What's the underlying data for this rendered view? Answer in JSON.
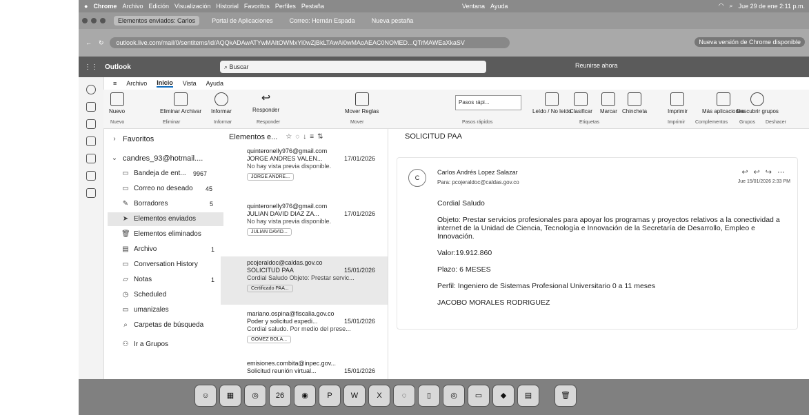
{
  "menubar": {
    "items": [
      "Chrome",
      "Archivo",
      "Edición",
      "Visualización",
      "Historial",
      "Favoritos",
      "Perfiles",
      "Pestaña",
      "Ventana",
      "Ayuda"
    ],
    "datetime": "Jue 29 de ene 2:11 p.m."
  },
  "tabs": [
    {
      "label": "Elementos enviados: Carlos"
    },
    {
      "label": "Portal de Aplicaciones"
    },
    {
      "label": "Correo: Hernán Espada"
    },
    {
      "label": "Nueva pestaña"
    }
  ],
  "address": {
    "url": "outlook.live.com/mail/0/sentitems/id/AQQkADAwATYwMAItOWMxYi0wZjBkLTAwAi0wMAoAEAC0NOMED...QTrMAWEaXkaSV",
    "new_version": "Nueva versión de Chrome disponible"
  },
  "outlook_header": {
    "app_name": "Outlook",
    "search_placeholder": "Buscar",
    "meet_now": "Reunirse ahora"
  },
  "ribbon": {
    "tabs": [
      "Archivo",
      "Inicio",
      "Vista",
      "Ayuda"
    ],
    "buttons": {
      "new": "Nuevo",
      "delete_archive": "Eliminar Archivar",
      "report": "Informar",
      "reply": "Responder",
      "move_rules": "Mover Reglas",
      "quick_steps": "Pasos rápi...",
      "unread": "Leído / No leído",
      "categorize": "Clasificar",
      "flag": "Marcar",
      "pin": "Chincheta",
      "print": "Imprimir",
      "more_apps": "Más aplicaciones",
      "discover_groups": "Descubrir grupos"
    },
    "groups": [
      "Nuevo",
      "Eliminar",
      "Informar",
      "Responder",
      "Mover",
      "Pasos rápidos",
      "Etiquetas",
      "Imprimir",
      "Complementos",
      "Grupos",
      "Deshacer"
    ]
  },
  "folders": {
    "favorites": "Favoritos",
    "account": "candres_93@hotmail....",
    "items": [
      {
        "label": "Bandeja de ent...",
        "count": "9967",
        "icon": "inbox-icon"
      },
      {
        "label": "Correo no deseado",
        "count": "45",
        "icon": "junk-icon"
      },
      {
        "label": "Borradores",
        "count": "5",
        "icon": "pencil-icon"
      },
      {
        "label": "Elementos enviados",
        "count": "",
        "icon": "send-icon"
      },
      {
        "label": "Elementos eliminados",
        "count": "",
        "icon": "trash-icon"
      },
      {
        "label": "Archivo",
        "count": "1",
        "icon": "archive-icon"
      },
      {
        "label": "Conversation History",
        "count": "",
        "icon": "folder-icon"
      },
      {
        "label": "Notas",
        "count": "1",
        "icon": "note-icon"
      },
      {
        "label": "Scheduled",
        "count": "",
        "icon": "clock-icon"
      },
      {
        "label": "umanizales",
        "count": "",
        "icon": "folder-icon"
      },
      {
        "label": "Carpetas de búsqueda",
        "count": "",
        "icon": "search-folder-icon"
      },
      {
        "label": "Ir a Grupos",
        "count": "",
        "icon": "groups-icon"
      }
    ]
  },
  "message_list": {
    "title": "Elementos e...",
    "messages": [
      {
        "from": "quinteronelly976@gmail.com",
        "subject": "JORGE ANDRES VALEN...",
        "date": "17/01/2026",
        "preview": "No hay vista previa disponible.",
        "attachment": "JORGE ANDRE..."
      },
      {
        "from": "quinteronelly976@gmail.com",
        "subject": "JULIAN DAVID DIAZ ZA...",
        "date": "17/01/2026",
        "preview": "No hay vista previa disponible.",
        "attachment": "JULIAN DAVID..."
      },
      {
        "from": "pcojeraldoc@caldas.gov.co",
        "subject": "SOLICITUD PAA",
        "date": "15/01/2026",
        "preview": "Cordial Saludo Objeto: Prestar servic...",
        "attachment": "Certificado PAA..."
      },
      {
        "from": "mariano.ospina@fiscalia.gov.co",
        "subject": "Poder y solicitud expedi...",
        "date": "15/01/2026",
        "preview": "Cordial saludo. Por medio del prese...",
        "attachment": "GOMEZ BOLA..."
      },
      {
        "from": "emisiones.combita@inpec.gov...",
        "subject": "Solicitud reunión virtual...",
        "date": "15/01/2026",
        "preview": "",
        "attachment": ""
      }
    ]
  },
  "reading": {
    "subject": "SOLICITUD PAA",
    "avatar": "C",
    "sender": "Carlos Andrés Lopez Salazar",
    "to": "Para: pcojeraldoc@caldas.gov.co",
    "date": "Jue 15/01/2026 2:33 PM",
    "body": [
      "Cordial Saludo",
      "Objeto: Prestar servicios profesionales para apoyar los programas y proyectos relativos a la conectividad a internet de la Unidad de Ciencia, Tecnología e Innovación de la Secretaría de Desarrollo, Empleo e Innovación.",
      "Valor:19.912.860",
      "Plazo: 6 MESES",
      "Perfil: Ingeniero de Sistemas Profesional Universitario 0 a 11 meses",
      "JACOBO MORALES RODRIGUEZ"
    ]
  },
  "dock": {
    "calendar_day": "26"
  }
}
